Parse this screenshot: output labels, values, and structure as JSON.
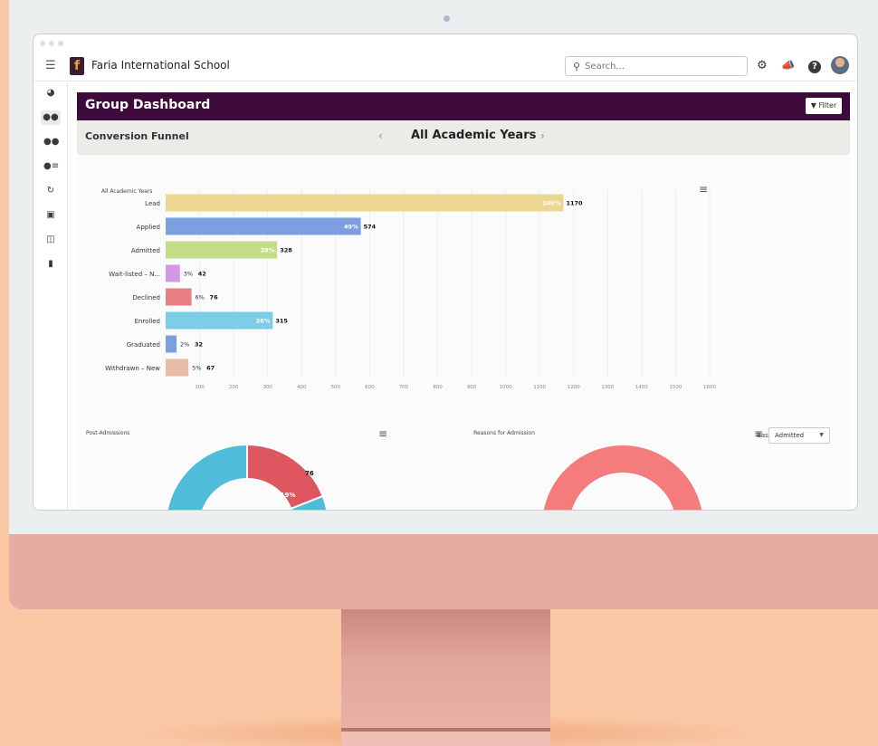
{
  "app": {
    "school_name": "Faria International School",
    "logo_letter": "f",
    "search_placeholder": "Search..."
  },
  "dashboard": {
    "title": "Group Dashboard",
    "filter_label": "Filter",
    "funnel_label": "Conversion Funnel",
    "year_label": "All Academic Years"
  },
  "chart_data": [
    {
      "type": "bar",
      "orientation": "horizontal",
      "title": "All Academic Years",
      "categories": [
        "Lead",
        "Applied",
        "Admitted",
        "Wait-listed – N...",
        "Declined",
        "Enrolled",
        "Graduated",
        "Withdrawn – New"
      ],
      "values": [
        1170,
        574,
        328,
        42,
        76,
        315,
        32,
        67
      ],
      "percent_labels": [
        "100%",
        "49%",
        "28%",
        "3%",
        "6%",
        "26%",
        "2%",
        "5%"
      ],
      "colors": [
        "#ecd792",
        "#7b9fe0",
        "#c5dc89",
        "#d497e6",
        "#e87f84",
        "#7ecde6",
        "#7b9fe0",
        "#e8bca7"
      ],
      "xticks": [
        100,
        200,
        300,
        400,
        500,
        600,
        700,
        800,
        900,
        1000,
        1100,
        1200,
        1300,
        1400,
        1500,
        1600
      ],
      "xlim": [
        0,
        1600
      ],
      "grid": true
    },
    {
      "type": "pie",
      "title": "Post-Admissions",
      "slice_labels": [
        "76"
      ],
      "slice_percent_labels": [
        "19%"
      ],
      "colors": [
        "#dd5660",
        "#4fbcda"
      ]
    },
    {
      "type": "pie",
      "title": "Reasons for Admission",
      "colors": [
        "#f47c7c"
      ]
    }
  ],
  "base_control": {
    "label": "Base",
    "selected": "Admitted"
  }
}
